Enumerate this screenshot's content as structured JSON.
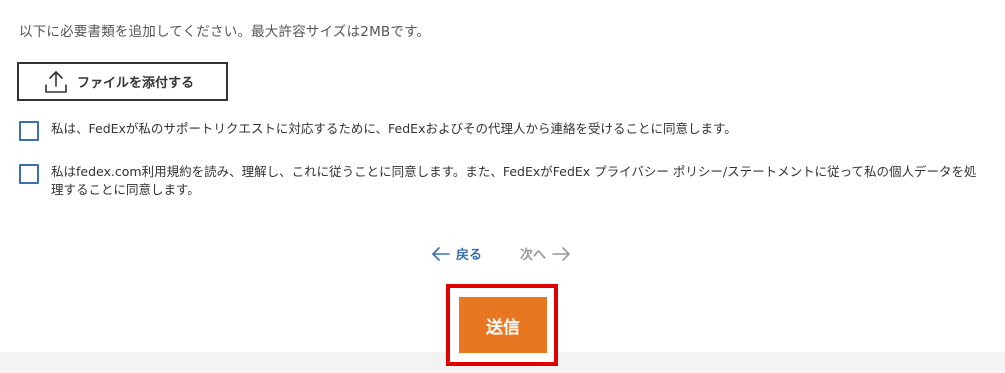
{
  "instruction": "以下に必要書類を追加してください。最大許容サイズは2MBです。",
  "upload": {
    "label": "ファイルを添付する",
    "icon": "upload-icon"
  },
  "consents": [
    {
      "text": "私は、FedExが私のサポートリクエストに対応するために、FedExおよびその代理人から連絡を受けることに同意します。",
      "checked": false
    },
    {
      "text": "私はfedex.com利用規約を読み、理解し、これに従うことに同意します。また、FedExがFedEx プライバシー ポリシー/ステートメントに従って私の個人データを処理することに同意します。",
      "checked": false
    }
  ],
  "nav": {
    "back_label": "戻る",
    "next_label": "次へ"
  },
  "submit": {
    "label": "送信"
  },
  "colors": {
    "accent": "#e87722",
    "link": "#3a6fb0",
    "highlight": "#e00000",
    "disabled": "#9a9a9a"
  }
}
